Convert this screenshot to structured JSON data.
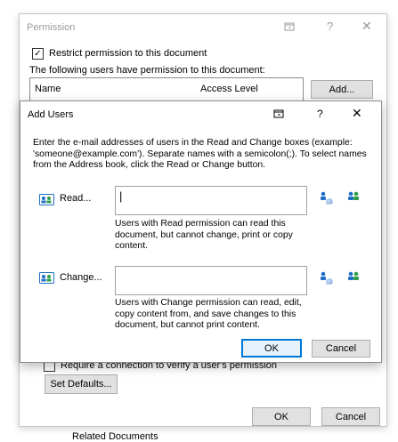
{
  "permission": {
    "title": "Permission",
    "restrict_label": "Restrict permission to this document",
    "users_label": "The following users have permission to this document:",
    "columns": [
      "Name",
      "Access Level"
    ],
    "add_button": "Add...",
    "require_connection_label": "Require a connection to verify a user's permission",
    "set_defaults_button": "Set Defaults...",
    "ok_button": "OK",
    "cancel_button": "Cancel"
  },
  "add_users": {
    "title": "Add Users",
    "instructions": "Enter the e-mail addresses of users in the Read and Change boxes (example: 'someone@example.com'). Separate names with a semicolon(;). To select names from the Address book, click the Read or Change button.",
    "read_button": "Read...",
    "read_value": "",
    "read_help": "Users with Read permission can read this document, but cannot change, print or copy content.",
    "change_button": "Change...",
    "change_value": "",
    "change_help": "Users with Change permission can read, edit, copy content from, and save changes to this document, but cannot print content.",
    "ok_button": "OK",
    "cancel_button": "Cancel"
  },
  "background_text": "Related Documents",
  "colors": {
    "accent": "#0078d7",
    "icon_blue": "#1f6fc5",
    "icon_green": "#2e9e4a",
    "disabled_text": "#9a9a9a"
  }
}
